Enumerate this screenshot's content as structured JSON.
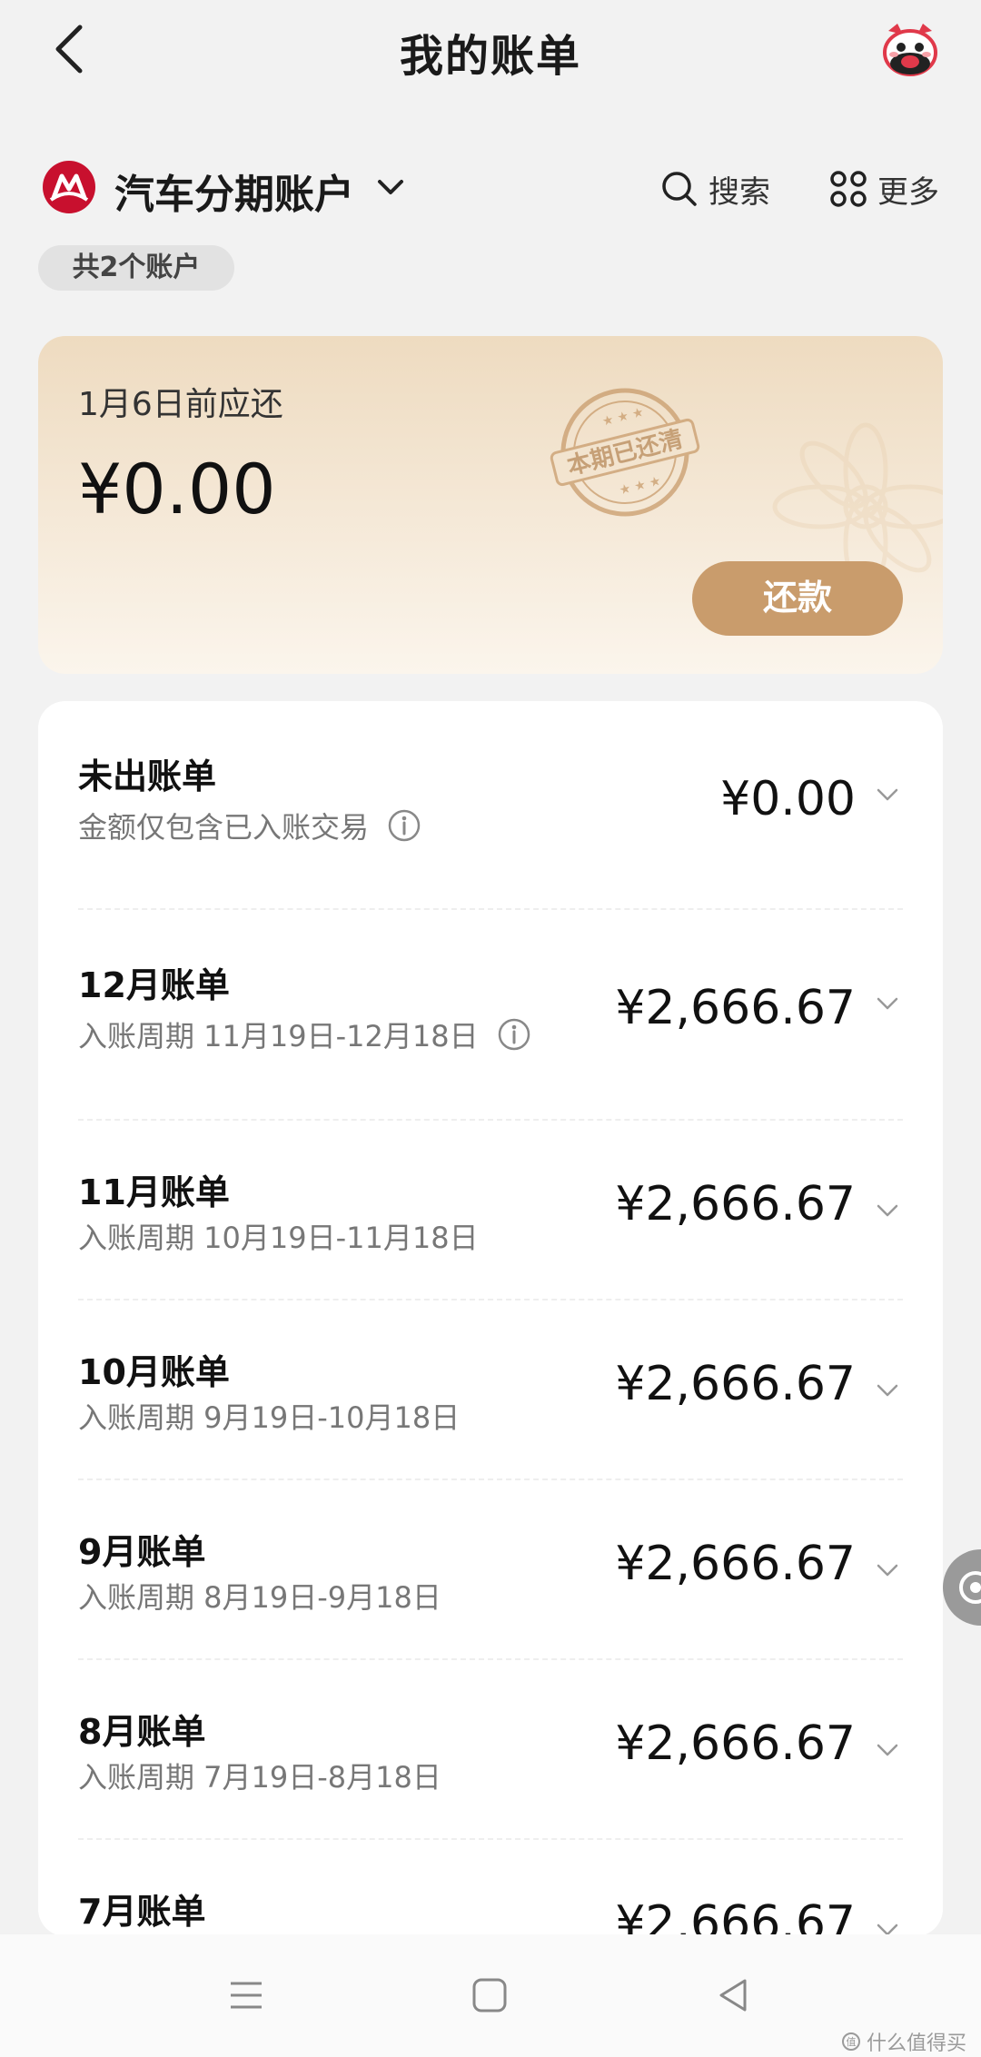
{
  "header": {
    "title": "我的账单"
  },
  "account": {
    "name": "汽车分期账户",
    "search_label": "搜索",
    "more_label": "更多",
    "count_label": "共2个账户"
  },
  "due_card": {
    "label": "1月6日前应还",
    "amount": "¥0.00",
    "stamp_text": "本期已还清",
    "repay_label": "还款"
  },
  "bills": [
    {
      "title": "未出账单",
      "subtitle": "金额仅包含已入账交易",
      "amount": "¥0.00",
      "has_info": true
    },
    {
      "title": "12月账单",
      "subtitle": "入账周期 11月19日-12月18日",
      "amount": "¥2,666.67",
      "has_info": true
    },
    {
      "title": "11月账单",
      "subtitle": "入账周期 10月19日-11月18日",
      "amount": "¥2,666.67",
      "has_info": false
    },
    {
      "title": "10月账单",
      "subtitle": "入账周期 9月19日-10月18日",
      "amount": "¥2,666.67",
      "has_info": false
    },
    {
      "title": "9月账单",
      "subtitle": "入账周期 8月19日-9月18日",
      "amount": "¥2,666.67",
      "has_info": false
    },
    {
      "title": "8月账单",
      "subtitle": "入账周期 7月19日-8月18日",
      "amount": "¥2,666.67",
      "has_info": false
    },
    {
      "title": "7月账单",
      "subtitle": "",
      "amount": "¥2,666.67",
      "has_info": false
    }
  ],
  "watermark": "什么值得买",
  "colors": {
    "accent_gold": "#c99c6c",
    "brand_red": "#c8102e",
    "page_bg": "#f2f2f2"
  },
  "icons": {
    "back": "chevron-left-icon",
    "mascot": "mascot-avatar-icon",
    "search": "search-icon",
    "more": "grid-more-icon",
    "info": "info-icon",
    "row_chevron": "chevron-down-icon"
  }
}
